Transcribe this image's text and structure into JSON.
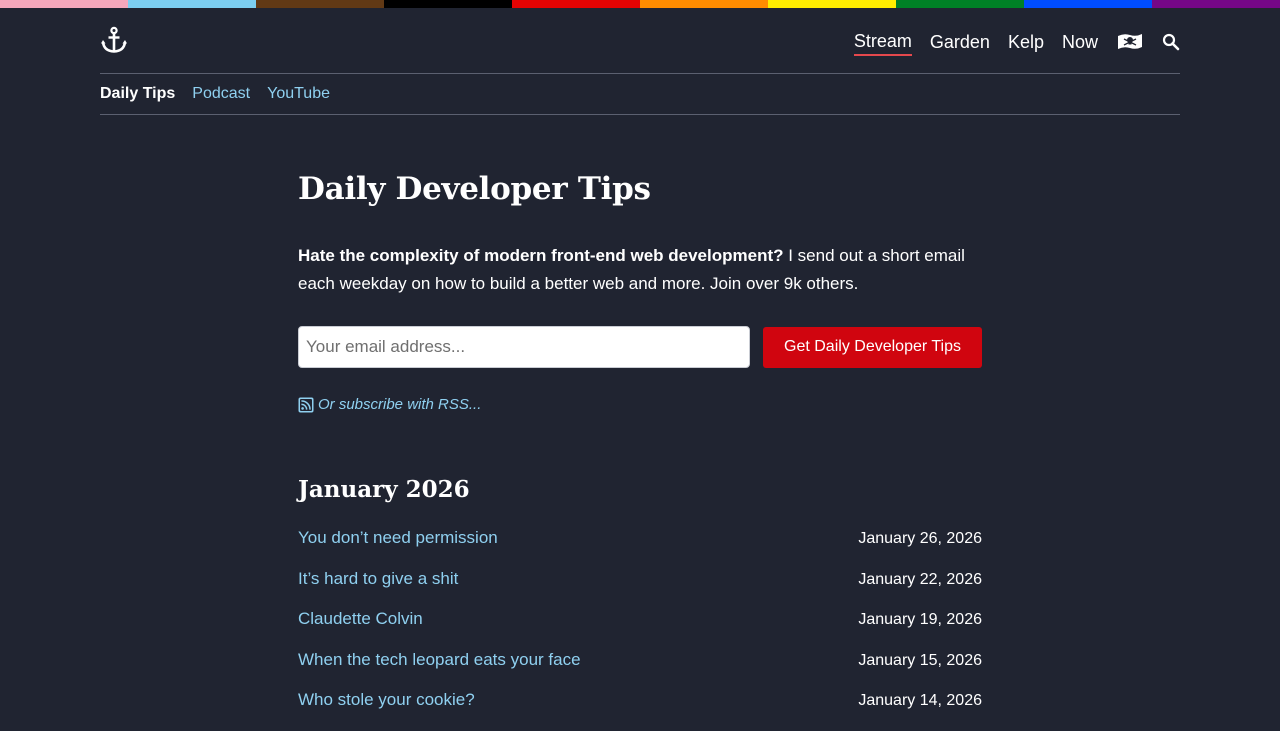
{
  "stripes": [
    "#f4a7bb",
    "#7ccef0",
    "#613915",
    "#000000",
    "#e40303",
    "#ff8c00",
    "#ffed00",
    "#008026",
    "#004dff",
    "#750787"
  ],
  "header": {
    "logo_icon": "anchor-icon",
    "nav": [
      {
        "label": "Stream",
        "active": true
      },
      {
        "label": "Garden",
        "active": false
      },
      {
        "label": "Kelp",
        "active": false
      },
      {
        "label": "Now",
        "active": false
      }
    ],
    "pirate_icon": "pirate-flag-icon",
    "search_icon": "search-icon"
  },
  "subnav": {
    "items": [
      {
        "label": "Daily Tips",
        "current": true
      },
      {
        "label": "Podcast",
        "current": false
      },
      {
        "label": "YouTube",
        "current": false
      }
    ]
  },
  "main": {
    "title": "Daily Developer Tips",
    "intro_bold": "Hate the complexity of modern front-end web development?",
    "intro_rest": " I send out a short email each weekday on how to build a better web and more. Join over 9k others.",
    "email_placeholder": "Your email address...",
    "submit_label": "Get Daily Developer Tips",
    "rss_icon": "rss-icon",
    "rss_label": "Or subscribe with RSS...",
    "month": "January 2026",
    "posts": [
      {
        "title": "You don’t need permission",
        "date": "January 26, 2026"
      },
      {
        "title": "It’s hard to give a shit",
        "date": "January 22, 2026"
      },
      {
        "title": "Claudette Colvin",
        "date": "January 19, 2026"
      },
      {
        "title": "When the tech leopard eats your face",
        "date": "January 15, 2026"
      },
      {
        "title": "Who stole your cookie?",
        "date": "January 14, 2026"
      }
    ]
  },
  "colors": {
    "background": "#202431",
    "link": "#8fd0f0",
    "button": "#d0050f",
    "active_underline": "#e5484d"
  }
}
